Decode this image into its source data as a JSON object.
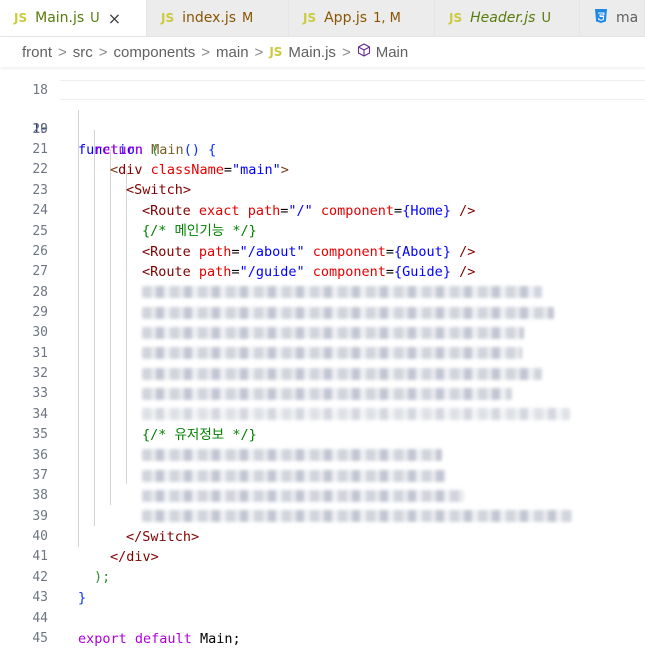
{
  "tabs": [
    {
      "icon": "JS",
      "name": "Main.js",
      "status": "U",
      "close": "×"
    },
    {
      "icon": "JS",
      "name": "index.js",
      "status": "M"
    },
    {
      "icon": "JS",
      "name": "App.js",
      "status": "1, M"
    },
    {
      "icon": "JS",
      "name": "Header.js",
      "status": "U"
    },
    {
      "icon": "CSS",
      "name": "ma"
    }
  ],
  "breadcrumb": {
    "parts": [
      "front",
      "src",
      "components",
      "main"
    ],
    "file_icon": "JS",
    "file": "Main.js",
    "symbol": "Main",
    "sep": ">"
  },
  "lines": {
    "l18": "18",
    "l19": "19",
    "l20": "20",
    "l21": "21",
    "l22": "22",
    "l23": "23",
    "l24": "24",
    "l25": "25",
    "l26": "26",
    "l27": "27",
    "l28": "28",
    "l29": "29",
    "l30": "30",
    "l31": "31",
    "l32": "32",
    "l33": "33",
    "l34": "34",
    "l35": "35",
    "l36": "36",
    "l37": "37",
    "l38": "38",
    "l39": "39",
    "l40": "40",
    "l41": "41",
    "l42": "42",
    "l43": "43",
    "l44": "44",
    "l45": "45"
  },
  "code": {
    "kw_function": "function",
    "fn_main": "Main",
    "paren_open": "()",
    "brace_open": "{",
    "kw_return": "return",
    "return_paren": "(",
    "div_open_lt": "<",
    "div_tag": "div",
    "div_attr": "className",
    "eq": "=",
    "div_class_val": "\"main\"",
    "gt": ">",
    "switch_tag": "Switch",
    "route_tag": "Route",
    "exact_attr": "exact",
    "path_attr": "path",
    "component_attr": "component",
    "path_root": "\"/\"",
    "home_comp": "{Home}",
    "self_close": "/>",
    "comment_main": "{/* 메인기능 */}",
    "path_about": "\"/about\"",
    "about_comp": "{About}",
    "path_guide": "\"/guide\"",
    "guide_comp": "{Guide}",
    "comment_user": "{/* 유저정보 */}",
    "switch_close": "</Switch>",
    "div_close": "</div>",
    "return_close": ");",
    "brace_close": "}",
    "kw_export": "export",
    "kw_default": "default",
    "export_name": "Main;"
  },
  "icons": {
    "close": "close-icon",
    "symbol": "cube-icon"
  }
}
